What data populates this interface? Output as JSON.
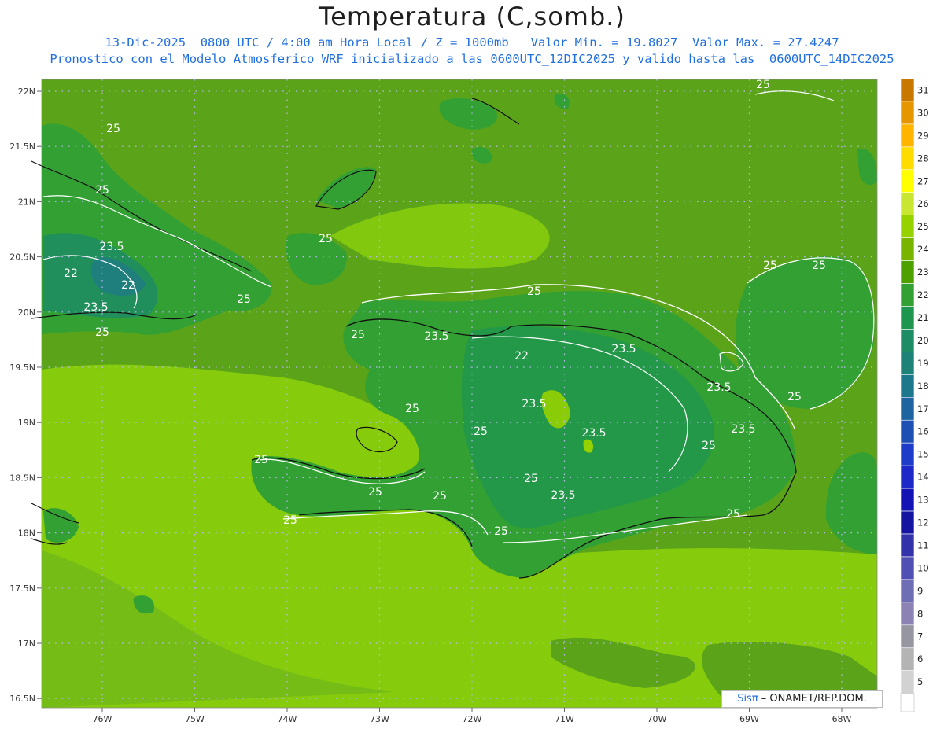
{
  "title": "Temperatura (C,somb.)",
  "subtitle_1": "13-Dic-2025  0800 UTC / 4:00 am Hora Local / Z = 1000mb   Valor Min. = 19.8027  Valor Max. = 27.4247",
  "subtitle_2": "Pronostico con el Modelo Atmosferico WRF inicializado a las 0600UTC_12DIC2025 y valido hasta las  0600UTC_14DIC2025",
  "map": {
    "lat_labels": [
      "22N",
      "21.5N",
      "21N",
      "20.5N",
      "20N",
      "19.5N",
      "19N",
      "18.5N",
      "18N",
      "17.5N",
      "17N",
      "16.5N"
    ],
    "lon_labels": [
      "76W",
      "75W",
      "74W",
      "73W",
      "72W",
      "71W",
      "70W",
      "69W",
      "68W"
    ],
    "contour_labels": [
      "25",
      "25",
      "25",
      "25",
      "23.5",
      "22",
      "22",
      "23.5",
      "25",
      "25",
      "25",
      "25",
      "25",
      "23.5",
      "22",
      "23.5",
      "23.5",
      "25",
      "25",
      "25",
      "23.5",
      "23.5",
      "23.5",
      "25",
      "25",
      "25",
      "23.5",
      "25",
      "25",
      "25",
      "25",
      "25",
      "25"
    ]
  },
  "colorbar": {
    "levels": [
      "31",
      "30",
      "29",
      "28",
      "27",
      "26",
      "25",
      "24",
      "23",
      "22",
      "21",
      "20",
      "19",
      "18",
      "17",
      "16",
      "15",
      "14",
      "13",
      "12",
      "11",
      "10",
      "9",
      "8",
      "7",
      "6",
      "5"
    ],
    "colors": [
      "#c87800",
      "#e69600",
      "#ffb400",
      "#ffdc00",
      "#ffff00",
      "#c8e632",
      "#96d200",
      "#78b400",
      "#4ea000",
      "#32a032",
      "#1e9650",
      "#1e8c64",
      "#1e8278",
      "#1e788c",
      "#1e64a0",
      "#1e50b4",
      "#1e3cc8",
      "#1e28c8",
      "#1414b4",
      "#1414a0",
      "#3232aa",
      "#5050b4",
      "#6e6eb4",
      "#8c82b4",
      "#9696a0",
      "#b4b4b4",
      "#d2d2d2"
    ]
  },
  "credit": {
    "logo": "Sisπ",
    "text": " – ONAMET/REP.DOM."
  }
}
